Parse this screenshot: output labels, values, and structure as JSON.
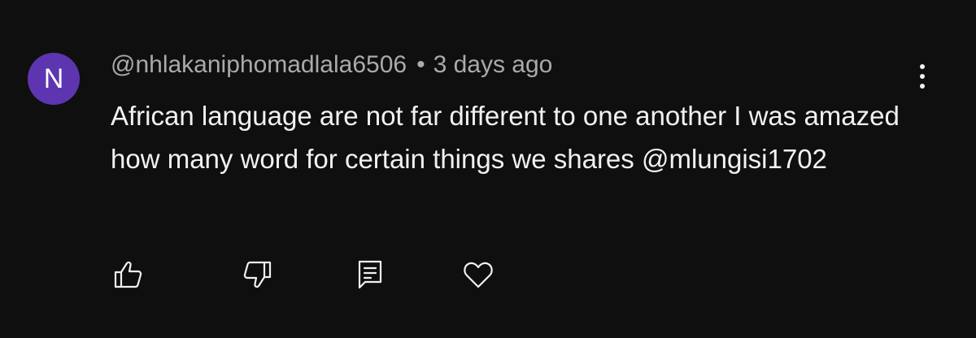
{
  "comment": {
    "avatar_initial": "N",
    "avatar_color": "#5e35b1",
    "author": "@nhlakaniphomadlala6506",
    "separator": "•",
    "timestamp": "3 days ago",
    "text": "African language are not far different to one another I was amazed how many word for certain things we shares @mlungisi1702"
  },
  "actions": {
    "like_icon": "thumbs-up-icon",
    "dislike_icon": "thumbs-down-icon",
    "reply_icon": "reply-comment-icon",
    "heart_icon": "heart-icon",
    "more_icon": "more-vertical-icon"
  }
}
